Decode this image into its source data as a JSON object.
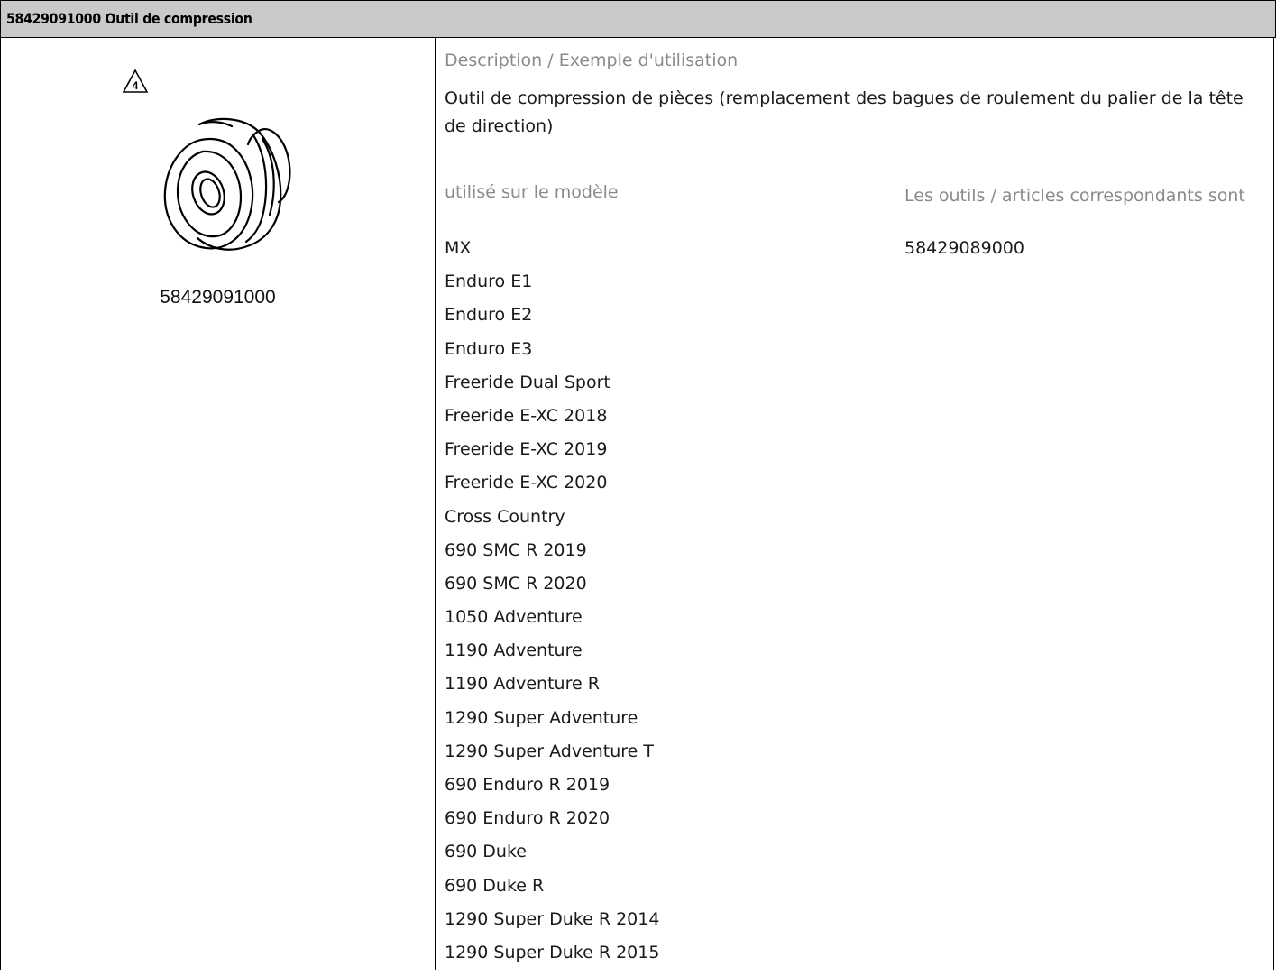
{
  "header": {
    "title": "58429091000 Outil de compression"
  },
  "left": {
    "warning_number": "4",
    "part_number": "58429091000",
    "warning_icon": "triangle-warning-icon",
    "tool_image": "compression-tool-drawing"
  },
  "right": {
    "description_label": "Description / Exemple d'utilisation",
    "description_text": "Outil de compression de pièces (remplacement des bagues de roulement du palier de la tête de direction)",
    "used_on_label": "utilisé sur le modèle",
    "related_label": "Les outils / articles correspondants sont",
    "related_value": "58429089000",
    "models": [
      "MX",
      "Enduro E1",
      "Enduro E2",
      "Enduro E3",
      "Freeride Dual Sport",
      "Freeride E-XC 2018",
      "Freeride E-XC 2019",
      "Freeride E-XC 2020",
      "Cross Country",
      "690 SMC R 2019",
      "690 SMC R 2020",
      "1050 Adventure",
      "1190 Adventure",
      "1190 Adventure R",
      "1290 Super Adventure",
      "1290 Super Adventure T",
      "690 Enduro R 2019",
      "690 Enduro R 2020",
      "690 Duke",
      "690 Duke R",
      "1290 Super Duke R 2014",
      "1290 Super Duke R 2015"
    ]
  }
}
